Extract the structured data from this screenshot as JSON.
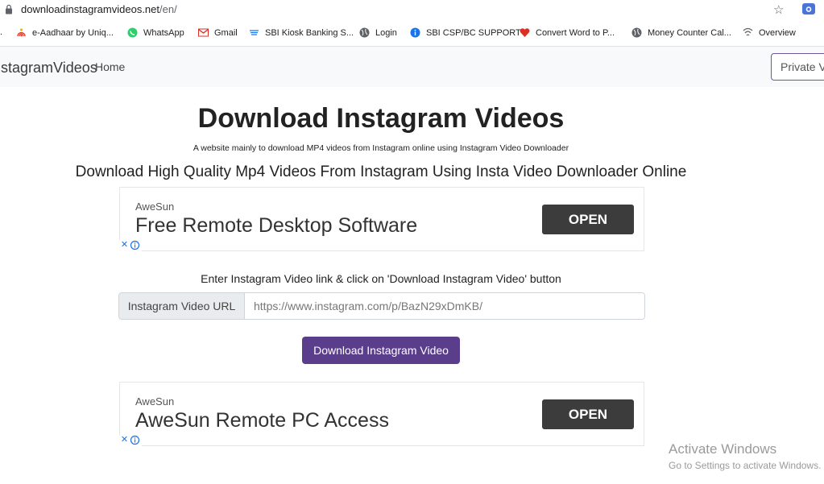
{
  "browser": {
    "url_host": "downloadinstagramvideos.net",
    "url_path": "/en/",
    "bookmarks": [
      {
        "label": "e-Aadhaar by Uniq...",
        "icon": "aadhaar-icon"
      },
      {
        "label": "WhatsApp",
        "icon": "whatsapp-icon"
      },
      {
        "label": "Gmail",
        "icon": "gmail-icon"
      },
      {
        "label": "SBI Kiosk Banking S...",
        "icon": "sbi-icon"
      },
      {
        "label": "Login",
        "icon": "globe-icon"
      },
      {
        "label": "SBI CSP/BC SUPPORT",
        "icon": "info-icon"
      },
      {
        "label": "Convert Word to P...",
        "icon": "heart-icon"
      },
      {
        "label": "Money Counter Cal...",
        "icon": "globe-icon"
      },
      {
        "label": "Overview",
        "icon": "overview-icon"
      }
    ]
  },
  "navbar": {
    "brand": "InstagramVideos",
    "home": "Home",
    "private_button": "Private Videos"
  },
  "main": {
    "title": "Download Instagram Videos",
    "subtitle": "A website mainly to download MP4 videos from Instagram online using Instagram Video Downloader",
    "heading": "Download High Quality Mp4 Videos From Instagram Using Insta Video Downloader Online",
    "instruction": "Enter Instagram Video link & click on 'Download Instagram Video' button",
    "input_label": "Instagram Video URL",
    "input_placeholder": "https://www.instagram.com/p/BazN29xDmKB/",
    "download_button": "Download Instagram Video"
  },
  "ads": [
    {
      "brand": "AweSun",
      "headline": "Free Remote Desktop Software",
      "button": "OPEN"
    },
    {
      "brand": "AweSun",
      "headline": "AweSun Remote PC Access",
      "button": "OPEN"
    }
  ],
  "watermark": {
    "line1": "Activate Windows",
    "line2": "Go to Settings to activate Windows."
  },
  "colors": {
    "accent": "#5a3e8c",
    "ad_button": "#3c3c3c",
    "navbar_bg": "#f8f9fa"
  }
}
